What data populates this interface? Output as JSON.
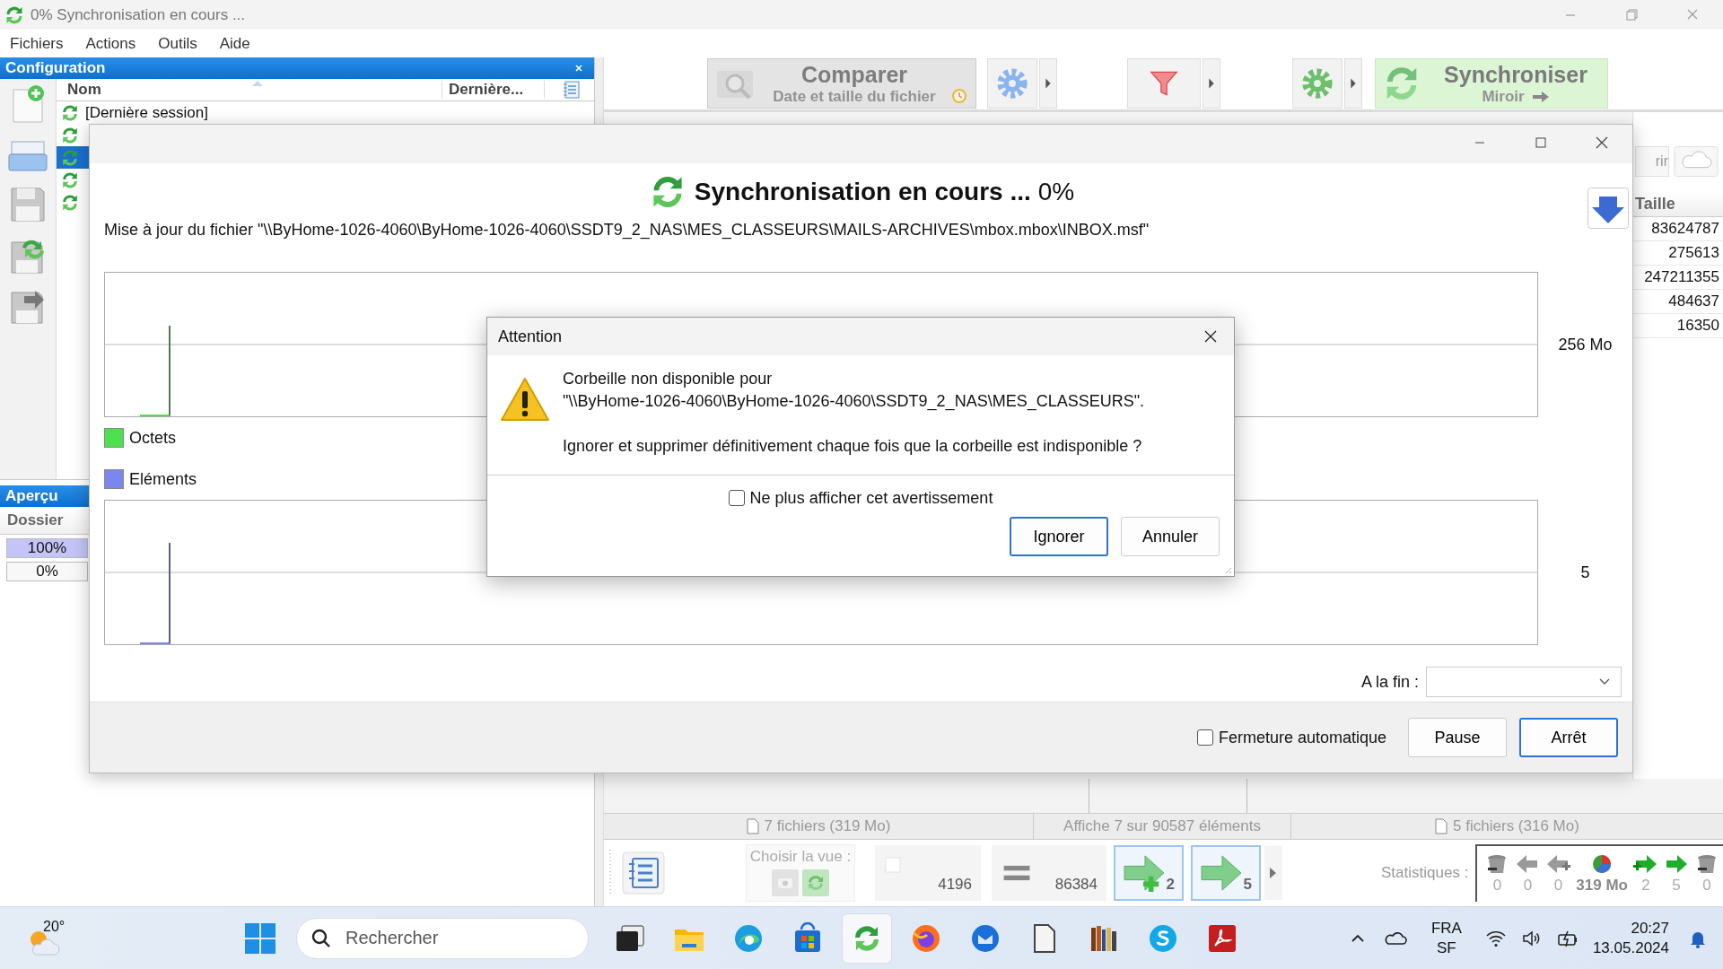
{
  "window": {
    "title": "0% Synchronisation en cours ..."
  },
  "menu": [
    "Fichiers",
    "Actions",
    "Outils",
    "Aide"
  ],
  "config_panel": {
    "title": "Configuration",
    "columns": [
      "Nom",
      "Dernière..."
    ],
    "rows": [
      {
        "name": "[Dernière session]",
        "selected": false
      },
      {
        "selected": false
      },
      {
        "selected": true
      },
      {
        "selected": false
      },
      {
        "selected": false
      }
    ]
  },
  "overview": {
    "title": "Aperçu",
    "column": "Dossier",
    "bars": [
      {
        "label": "100%",
        "level": 1
      },
      {
        "label": "0%",
        "level": 0
      }
    ]
  },
  "toolbar": {
    "compare": {
      "label": "Comparer",
      "sub": "Date et taille du fichier"
    },
    "sync": {
      "label": "Synchroniser",
      "sub": "Miroir"
    }
  },
  "right_list": {
    "button": "rir",
    "column": "Taille",
    "sizes": [
      "83624787",
      "275613",
      "247211355",
      "484637",
      "16350"
    ]
  },
  "status_bar": [
    "7 fichiers (319 Mo)",
    "Affiche 7 sur 90587 éléments",
    "5 fichiers (316 Mo)"
  ],
  "bottom_toolbar": {
    "view_label": "Choisir la vue :",
    "counts": [
      {
        "kind": "checkbox",
        "value": "4196",
        "selected": false
      },
      {
        "kind": "equal",
        "value": "86384",
        "selected": false
      },
      {
        "kind": "create",
        "value": "2",
        "selected": true
      },
      {
        "kind": "update",
        "value": "5",
        "selected": true
      }
    ],
    "stats_label": "Statistiques :",
    "stats": [
      {
        "kind": "delete-left",
        "value": "0"
      },
      {
        "kind": "overwrite-left",
        "value": "0"
      },
      {
        "kind": "create-left",
        "value": "0"
      },
      {
        "kind": "volume",
        "value": "319 Mo"
      },
      {
        "kind": "create-right",
        "value": "2"
      },
      {
        "kind": "overwrite-right",
        "value": "5"
      },
      {
        "kind": "delete-right",
        "value": "0"
      }
    ]
  },
  "progress_dialog": {
    "heading": "Synchronisation en cours ...",
    "percent": "0%",
    "message": "Mise à jour du fichier \"\\\\ByHome-1026-4060\\ByHome-1026-4060\\SSDT9_2_NAS\\MES_CLASSEURS\\MAILS-ARCHIVES\\mbox.mbox\\INBOX.msf\"",
    "graphs": [
      {
        "legend": "Octets",
        "color": "#4fe04f",
        "axis": "256 Mo"
      },
      {
        "legend": "Eléments",
        "color": "#7b86ee",
        "axis": "5"
      }
    ],
    "end_label": "A la fin :",
    "auto_close": {
      "label": "Fermeture automatique",
      "checked": false
    },
    "buttons": [
      "Pause",
      "Arrêt"
    ]
  },
  "attention_dialog": {
    "title": "Attention",
    "lines": [
      "Corbeille non disponible pour",
      "\"\\\\ByHome-1026-4060\\ByHome-1026-4060\\SSDT9_2_NAS\\MES_CLASSEURS\".",
      "Ignorer et supprimer définitivement chaque fois que la corbeille est indisponible ?"
    ],
    "checkbox": {
      "label": "Ne plus afficher cet avertissement",
      "checked": false
    },
    "buttons": [
      {
        "label": "Ignorer",
        "default": true
      },
      {
        "label": "Annuler",
        "default": false
      }
    ]
  },
  "taskbar": {
    "weather": "20°",
    "search_placeholder": "Rechercher",
    "apps": [
      {
        "kind": "taskview",
        "selected": false
      },
      {
        "kind": "explorer",
        "selected": false
      },
      {
        "kind": "edge",
        "selected": false
      },
      {
        "kind": "store",
        "selected": false
      },
      {
        "kind": "sync",
        "selected": true
      },
      {
        "kind": "firefox",
        "selected": false
      },
      {
        "kind": "thunderbird",
        "selected": false
      },
      {
        "kind": "document",
        "selected": false
      },
      {
        "kind": "library",
        "selected": false
      },
      {
        "kind": "skype",
        "selected": false
      },
      {
        "kind": "acrobat",
        "selected": false
      }
    ],
    "language": [
      "FRA",
      "SF"
    ],
    "time": "20:27",
    "date": "13.05.2024"
  }
}
